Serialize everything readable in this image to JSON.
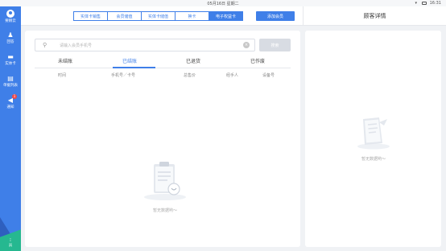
{
  "status_bar": {
    "date": "05月16日 星期二",
    "time": "16:31"
  },
  "sidebar": {
    "logo_label": "要顾云",
    "items": [
      {
        "label": "回答",
        "icon": "person-icon"
      },
      {
        "label": "实体卡",
        "icon": "card-icon"
      },
      {
        "label": "单据列表",
        "icon": "document-icon"
      },
      {
        "label": "通知",
        "icon": "megaphone-icon",
        "badge": "1"
      }
    ],
    "bottom_label": "员"
  },
  "top_tabs": [
    {
      "label": "实体卡销售",
      "active": false
    },
    {
      "label": "会员储值",
      "active": false
    },
    {
      "label": "实体卡储值",
      "active": false
    },
    {
      "label": "换卡",
      "active": false
    },
    {
      "label": "电子权益卡",
      "active": true
    }
  ],
  "add_member_button": "添加会员",
  "detail_title": "顾客详情",
  "search": {
    "placeholder": "请输入会员手机号",
    "button": "搜索"
  },
  "sub_tabs": [
    {
      "label": "未结账",
      "active": false
    },
    {
      "label": "已结账",
      "active": true
    },
    {
      "label": "已退货",
      "active": false
    },
    {
      "label": "已作废",
      "active": false
    }
  ],
  "columns": [
    "时间",
    "手机号／卡号",
    "总售价",
    "经手人",
    "设备号"
  ],
  "empty_text": "暂无数据哟～",
  "colors": {
    "accent": "#3f7fe8",
    "sidebar": "#3f7fe8",
    "green": "#26b890",
    "badge": "#f04848"
  }
}
